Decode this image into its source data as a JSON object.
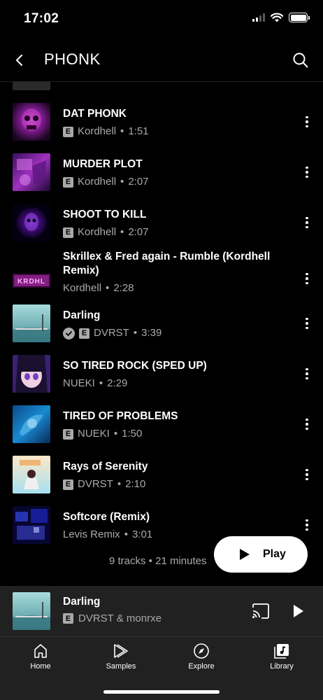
{
  "status_bar": {
    "time": "17:02"
  },
  "header": {
    "title": "PHONK"
  },
  "tracks": [
    {
      "title": "DAT PHONK",
      "explicit": true,
      "verified": false,
      "artist": "Kordhell",
      "duration": "1:51"
    },
    {
      "title": "MURDER PLOT",
      "explicit": true,
      "verified": false,
      "artist": "Kordhell",
      "duration": "2:07"
    },
    {
      "title": "SHOOT TO KILL",
      "explicit": true,
      "verified": false,
      "artist": "Kordhell",
      "duration": "2:07"
    },
    {
      "title_line1": "Skrillex & Fred again - Rumble (Kordhell",
      "title_line2": "Remix)",
      "explicit": false,
      "verified": false,
      "artist": "Kordhell",
      "duration": "2:28"
    },
    {
      "title": "Darling",
      "explicit": true,
      "verified": true,
      "artist": "DVRST",
      "duration": "3:39"
    },
    {
      "title": "SO TIRED ROCK (SPED UP)",
      "explicit": false,
      "verified": false,
      "artist": "NUEKI",
      "duration": "2:29"
    },
    {
      "title": "TIRED OF PROBLEMS",
      "explicit": true,
      "verified": false,
      "artist": "NUEKI",
      "duration": "1:50"
    },
    {
      "title": "Rays of Serenity",
      "explicit": true,
      "verified": false,
      "artist": "DVRST",
      "duration": "2:10"
    },
    {
      "title": "Softcore (Remix)",
      "explicit": false,
      "verified": false,
      "artist": "Levis Remix",
      "duration": "3:01"
    }
  ],
  "explicit_badge": "E",
  "meta_separator": "•",
  "summary": "9 tracks • 21 minutes",
  "play_button": {
    "label": "Play"
  },
  "mini_player": {
    "title": "Darling",
    "artist": "DVRST & monrxe",
    "explicit": true
  },
  "bottom_nav": [
    {
      "label": "Home",
      "icon": "home-icon"
    },
    {
      "label": "Samples",
      "icon": "samples-icon"
    },
    {
      "label": "Explore",
      "icon": "compass-icon"
    },
    {
      "label": "Library",
      "icon": "library-icon"
    }
  ]
}
